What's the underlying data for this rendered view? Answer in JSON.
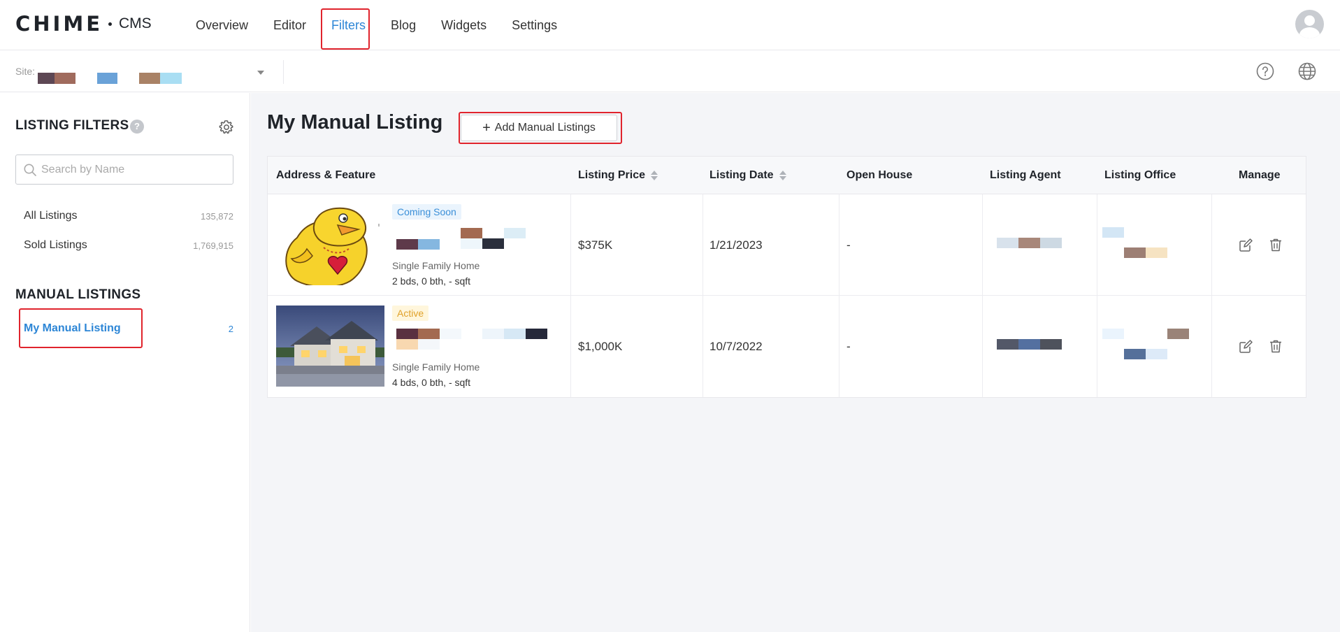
{
  "header": {
    "logo_text": "CHIME",
    "logo_suffix": "CMS",
    "nav": [
      {
        "label": "Overview",
        "active": false
      },
      {
        "label": "Editor",
        "active": false
      },
      {
        "label": "Filters",
        "active": true
      },
      {
        "label": "Blog",
        "active": false
      },
      {
        "label": "Widgets",
        "active": false
      },
      {
        "label": "Settings",
        "active": false
      }
    ],
    "avatar_icon": "user-avatar-icon"
  },
  "subbar": {
    "site_label": "Site:",
    "site_icon": "chevron-down-icon",
    "help_icon": "question-circle-icon",
    "language_icon": "globe-icon"
  },
  "sidebar": {
    "title": "LISTING FILTERS",
    "help_glyph": "?",
    "settings_icon": "gear-icon",
    "search_placeholder": "Search by Name",
    "filters": [
      {
        "label": "All Listings",
        "count": "135,872"
      },
      {
        "label": "Sold Listings",
        "count": "1,769,915"
      }
    ],
    "manual_title": "MANUAL LISTINGS",
    "manual_items": [
      {
        "label": "My Manual Listing",
        "count": "2",
        "active": true
      }
    ]
  },
  "main": {
    "title": "My Manual Listing",
    "add_button": "Add Manual Listings",
    "add_icon": "plus-icon",
    "columns": [
      {
        "label": "Address & Feature",
        "sortable": false
      },
      {
        "label": "Listing Price",
        "sortable": true
      },
      {
        "label": "Listing Date",
        "sortable": true
      },
      {
        "label": "Open House",
        "sortable": false
      },
      {
        "label": "Listing Agent",
        "sortable": false
      },
      {
        "label": "Listing Office",
        "sortable": false
      },
      {
        "label": "Manage",
        "sortable": false
      }
    ],
    "rows": [
      {
        "status": "Coming Soon",
        "status_type": "soon",
        "property_type": "Single Family Home",
        "specs": "2 bds, 0 bth, - sqft",
        "price": "$375K",
        "date": "1/21/2023",
        "open_house": "-",
        "image": "cartoon-bird-image"
      },
      {
        "status": "Active",
        "status_type": "active",
        "property_type": "Single Family Home",
        "specs": "4 bds, 0 bth, - sqft",
        "price": "$1,000K",
        "date": "10/7/2022",
        "open_house": "-",
        "image": "house-photo-image"
      }
    ],
    "edit_icon": "edit-icon",
    "delete_icon": "trash-icon"
  },
  "colors": {
    "accent": "#2d86d6",
    "highlight_box": "#e0242d",
    "tag_soon_bg": "#eaf4fd",
    "tag_active_bg": "#fff6dc"
  }
}
